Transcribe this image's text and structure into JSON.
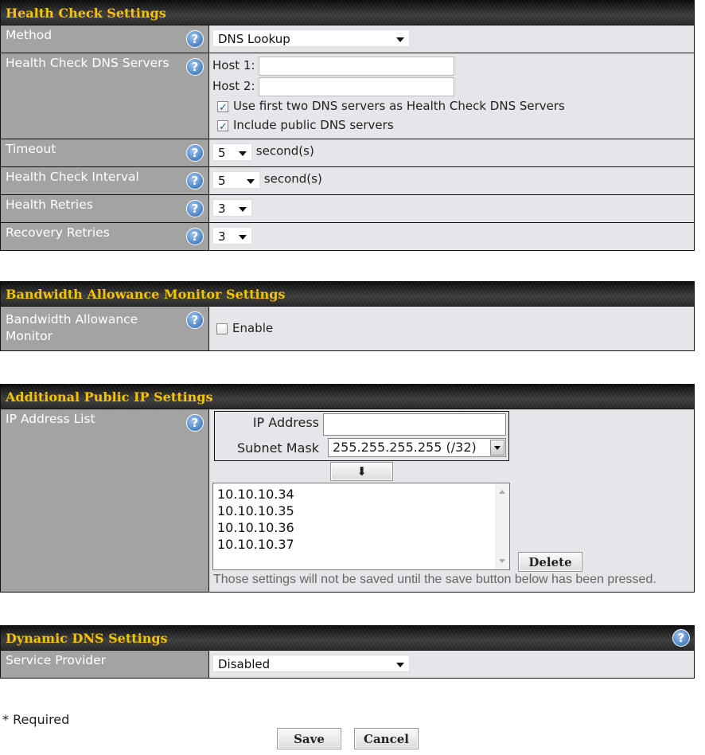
{
  "health_check": {
    "title": "Health Check Settings",
    "method": {
      "label": "Method",
      "value": "DNS Lookup"
    },
    "dns_servers": {
      "label": "Health Check DNS Servers",
      "host1_label": "Host 1:",
      "host1_value": "",
      "host2_label": "Host 2:",
      "host2_value": "",
      "use_first_two": {
        "label": "Use first two DNS servers as Health Check DNS Servers",
        "checked": true
      },
      "include_public": {
        "label": "Include public DNS servers",
        "checked": true
      }
    },
    "timeout": {
      "label": "Timeout",
      "value": "5",
      "unit": "second(s)"
    },
    "interval": {
      "label": "Health Check Interval",
      "value": "5",
      "unit": "second(s)"
    },
    "health_retries": {
      "label": "Health Retries",
      "value": "3"
    },
    "recovery_retries": {
      "label": "Recovery Retries",
      "value": "3"
    }
  },
  "bandwidth": {
    "title": "Bandwidth Allowance Monitor Settings",
    "monitor": {
      "label_line1": "Bandwidth Allowance",
      "label_line2": "Monitor",
      "enable_label": "Enable",
      "checked": false
    }
  },
  "public_ip": {
    "title": "Additional Public IP Settings",
    "list_label": "IP Address List",
    "ip_label": "IP Address",
    "ip_value": "",
    "mask_label": "Subnet Mask",
    "mask_value": "255.255.255.255 (/32)",
    "add_icon": "arrow-down-icon",
    "ips": [
      "10.10.10.34",
      "10.10.10.35",
      "10.10.10.36",
      "10.10.10.37"
    ],
    "delete_label": "Delete",
    "note": "Those settings will not be saved until the save button below has been pressed."
  },
  "ddns": {
    "title": "Dynamic DNS Settings",
    "provider": {
      "label": "Service Provider",
      "value": "Disabled"
    }
  },
  "footer": {
    "required": "* Required",
    "save": "Save",
    "cancel": "Cancel"
  },
  "help_glyph": "?",
  "colors": {
    "header_text": "#f7c300",
    "label_bg": "#a3a3a3",
    "value_bg": "#e6e6ea",
    "help_blue": "#4b82c4"
  }
}
